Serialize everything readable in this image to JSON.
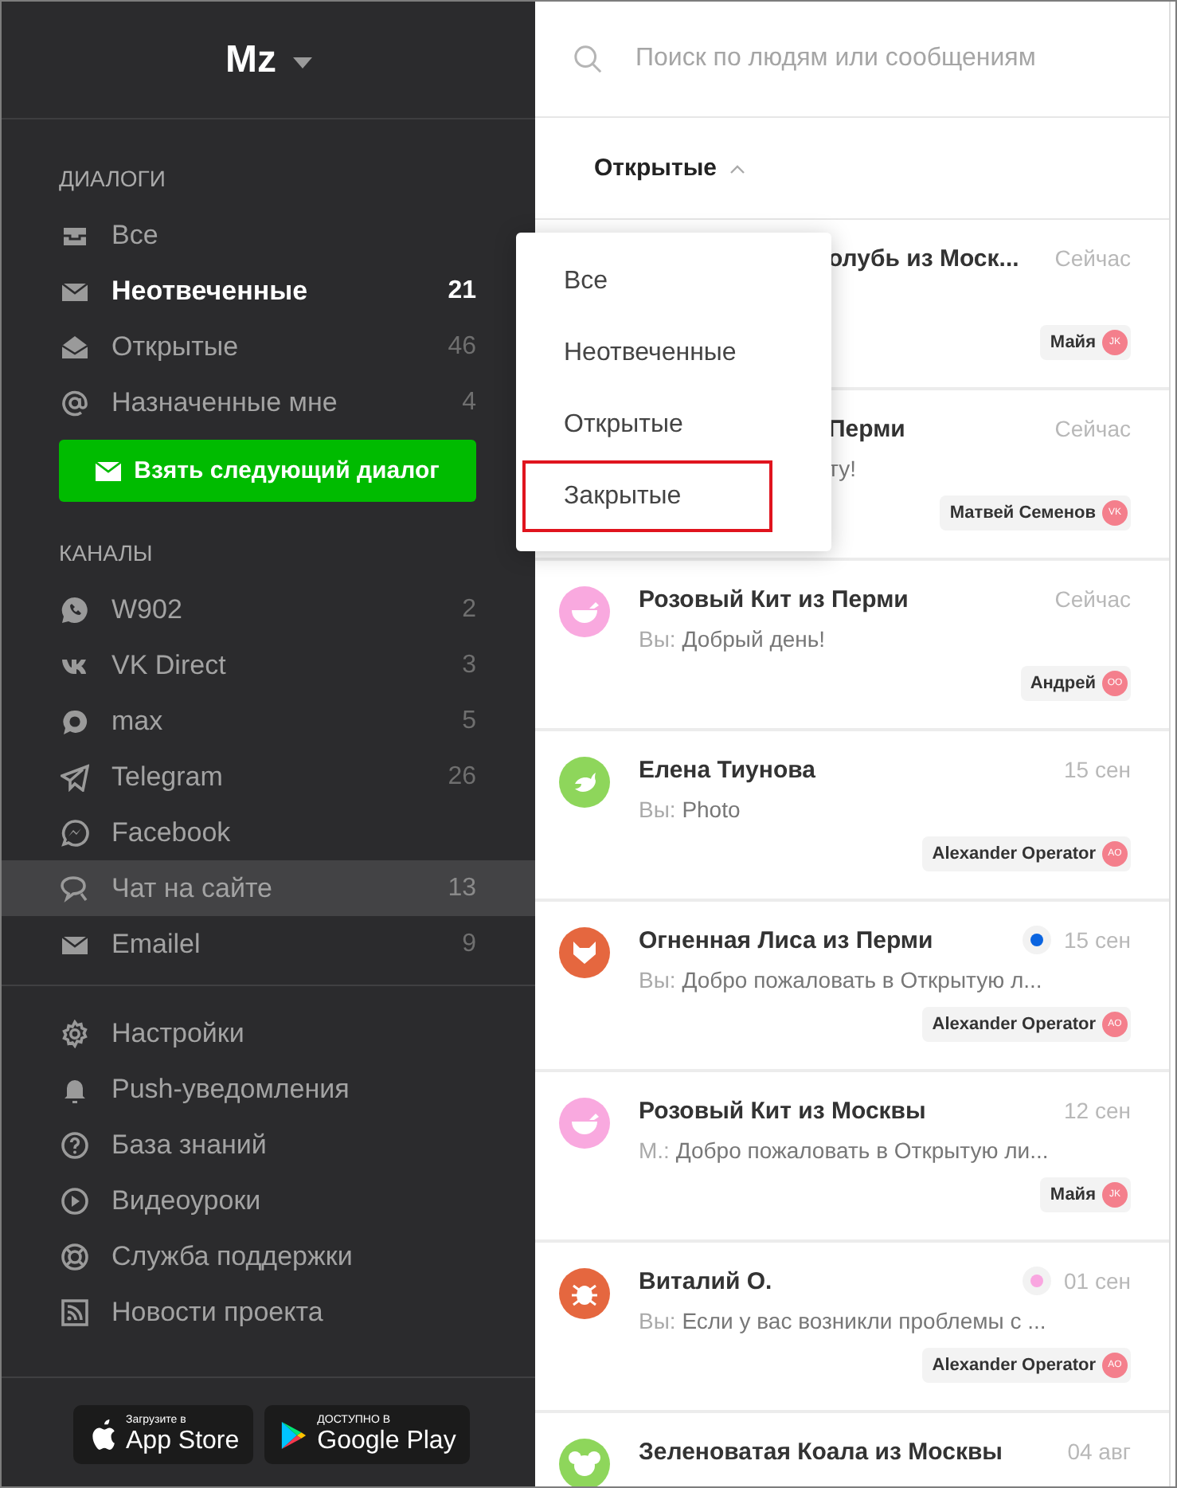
{
  "workspace": {
    "name": "Mz"
  },
  "dialogs": {
    "title": "ДИАЛОГИ",
    "items": [
      {
        "kind": "inbox",
        "label": "Все",
        "selected": false
      },
      {
        "kind": "envelope",
        "label": "Неотвеченные",
        "count": "21",
        "selected": true
      },
      {
        "kind": "open-envelope",
        "label": "Открытые",
        "count": "46",
        "selected": false
      },
      {
        "kind": "at",
        "label": "Назначенные мне",
        "count": "4",
        "selected": false
      }
    ]
  },
  "next_button": "Взять следующий диалог",
  "channels": {
    "title": "КАНАЛЫ",
    "items": [
      {
        "kind": "phone-bubble",
        "label": "W902",
        "count": "2",
        "selected": false
      },
      {
        "kind": "vk",
        "label": "VK Direct",
        "count": "3",
        "selected": false
      },
      {
        "kind": "bubble",
        "label": "max",
        "count": "5",
        "selected": false
      },
      {
        "kind": "paper-plane",
        "label": "Telegram",
        "count": "26",
        "selected": false
      },
      {
        "kind": "lightning-bubble",
        "label": "Facebook",
        "selected": false
      },
      {
        "kind": "chat",
        "label": "Чат на сайте",
        "count": "13",
        "selected": true
      },
      {
        "kind": "envelope",
        "label": "Emailel",
        "count": "9",
        "selected": false
      }
    ]
  },
  "links": [
    {
      "kind": "gear",
      "label": "Настройки"
    },
    {
      "kind": "bell",
      "label": "Push-уведомления"
    },
    {
      "kind": "question",
      "label": "База знаний"
    },
    {
      "kind": "play",
      "label": "Видеоуроки"
    },
    {
      "kind": "lifebuoy",
      "label": "Служба поддержки"
    },
    {
      "kind": "rss",
      "label": "Новости проекта"
    }
  ],
  "stores": [
    {
      "kind": "apple",
      "caption": "Загрузите в",
      "name": "App Store"
    },
    {
      "kind": "play-triangle",
      "caption": "ДОСТУПНО В",
      "name": "Google Play"
    }
  ],
  "search": {
    "placeholder": "Поиск по людям или сообщениям"
  },
  "filter": {
    "label": "Открытые",
    "expanded": true,
    "options": [
      {
        "label": "Все",
        "highlighted": false
      },
      {
        "label": "Неотвеченные",
        "highlighted": false
      },
      {
        "label": "Открытые",
        "highlighted": false
      },
      {
        "label": "Закрытые",
        "highlighted": true
      }
    ]
  },
  "conversations": [
    {
      "covered": true,
      "title": "олубь из Моск...",
      "time": "Сейчас",
      "operator": {
        "name": "Майя",
        "initials": "JK"
      }
    },
    {
      "covered": true,
      "title": "Перми",
      "message": "ту!",
      "time": "Сейчас",
      "operator": {
        "name": "Матвей Семенов",
        "initials": "VK"
      }
    },
    {
      "covered": false,
      "avatar": {
        "kind": "whale",
        "color": "#f9a9df"
      },
      "title": "Розовый Кит из Перми",
      "sender": "Вы:",
      "message": "Добрый день!",
      "time": "Сейчас",
      "operator": {
        "name": "Андрей",
        "initials": "OO"
      }
    },
    {
      "covered": false,
      "avatar": {
        "kind": "bird",
        "color": "#8ed65b"
      },
      "title": "Елена Тиунова",
      "sender": "Вы:",
      "message": "Photo",
      "time": "15 сен",
      "operator": {
        "name": "Alexander Operator",
        "initials": "AO"
      }
    },
    {
      "covered": false,
      "avatar": {
        "kind": "fox",
        "color": "#e5673f"
      },
      "title": "Огненная Лиса из Перми",
      "status": {
        "color": "#0a64e0"
      },
      "sender": "Вы:",
      "message": "Добро пожаловать в Открытую л...",
      "time": "15 сен",
      "operator": {
        "name": "Alexander Operator",
        "initials": "AO"
      }
    },
    {
      "covered": false,
      "avatar": {
        "kind": "whale",
        "color": "#f9a9df"
      },
      "title": "Розовый Кит из Москвы",
      "sender": "М.:",
      "message": "Добро пожаловать в Открытую ли...",
      "time": "12 сен",
      "operator": {
        "name": "Майя",
        "initials": "JK"
      }
    },
    {
      "covered": false,
      "avatar": {
        "kind": "bug",
        "color": "#e5673f"
      },
      "title": "Виталий О.",
      "status": {
        "color": "#f9a6e0"
      },
      "sender": "Вы:",
      "message": "Если у вас возникли проблемы с ...",
      "time": "01 сен",
      "operator": {
        "name": "Alexander Operator",
        "initials": "AO"
      }
    },
    {
      "covered": false,
      "avatar": {
        "kind": "koala",
        "color": "#8ed65b"
      },
      "title": "Зеленоватая Коала из Москвы",
      "time": "04 авг"
    }
  ]
}
